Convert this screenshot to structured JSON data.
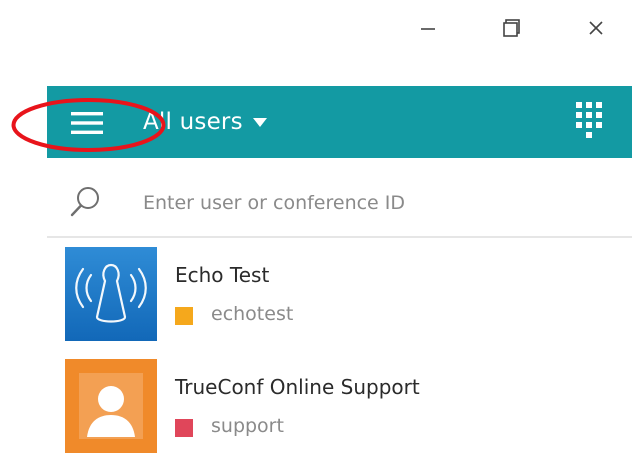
{
  "window_controls": {
    "minimize_icon": "minimize-icon",
    "maximize_icon": "maximize-icon",
    "close_icon": "close-icon"
  },
  "header": {
    "background_color": "#139aa3",
    "menu_icon": "hamburger-menu-icon",
    "filter_label": "All users",
    "filter_caret_icon": "caret-down-icon",
    "dialpad_icon": "dialpad-icon"
  },
  "annotation": {
    "color": "#e8141b",
    "shape": "ellipse"
  },
  "search": {
    "icon": "search-icon",
    "placeholder": "Enter user or conference ID",
    "value": ""
  },
  "contacts": [
    {
      "name": "Echo Test",
      "login": "echotest",
      "status_color": "#f5a81c",
      "avatar_icon": "echo-test-avatar",
      "avatar_color": "#1a74c4"
    },
    {
      "name": "TrueConf Online Support",
      "login": "support",
      "status_color": "#e0465a",
      "avatar_icon": "support-avatar",
      "avatar_color": "#f08a2a"
    }
  ]
}
